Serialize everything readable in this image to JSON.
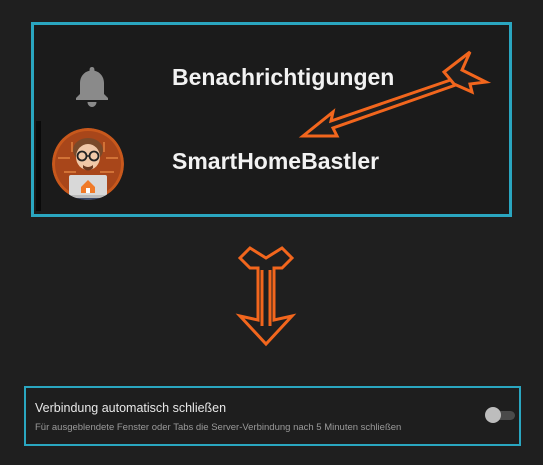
{
  "sidebar": {
    "items": [
      {
        "label": "Benachrichtigungen",
        "icon": "bell-icon"
      },
      {
        "label": "SmartHomeBastler",
        "icon": "avatar"
      }
    ]
  },
  "settings": {
    "auto_close": {
      "title": "Verbindung automatisch schließen",
      "description": "Für ausgeblendete Fenster oder Tabs die Server-Verbindung nach 5 Minuten schließen",
      "enabled": false
    }
  },
  "colors": {
    "background": "#1f1f1f",
    "highlight_border": "#2aa6c0",
    "annotation_arrow": "#f2661d",
    "text_primary": "#f2f2f2",
    "text_secondary": "#9a9a9a"
  }
}
